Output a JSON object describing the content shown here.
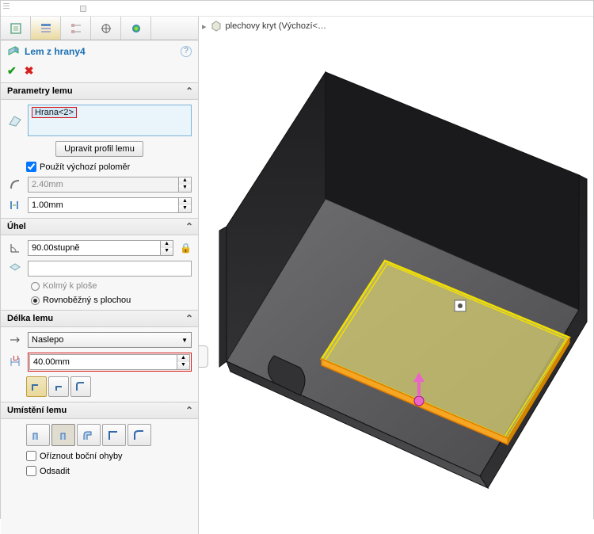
{
  "breadcrumb": {
    "item": "plechovy kryt  (Výchozí<…"
  },
  "feature": {
    "title": "Lem z hrany4"
  },
  "sections": {
    "params": {
      "title": "Parametry lemu",
      "selected_edge": "Hrana<2>",
      "edit_profile_btn": "Upravit profil lemu",
      "use_default_radius": "Použít výchozí poloměr",
      "radius_value": "2.40mm",
      "gap_value": "1.00mm"
    },
    "angle": {
      "title": "Úhel",
      "value": "90.00stupně",
      "face_value": "",
      "opt_perp": "Kolmý k ploše",
      "opt_parallel": "Rovnoběžný s plochou"
    },
    "length": {
      "title": "Délka lemu",
      "method": "Naslepo",
      "value": "40.00mm"
    },
    "position": {
      "title": "Umístění lemu",
      "trim": "Oříznout boční ohyby",
      "offset": "Odsadit"
    }
  }
}
